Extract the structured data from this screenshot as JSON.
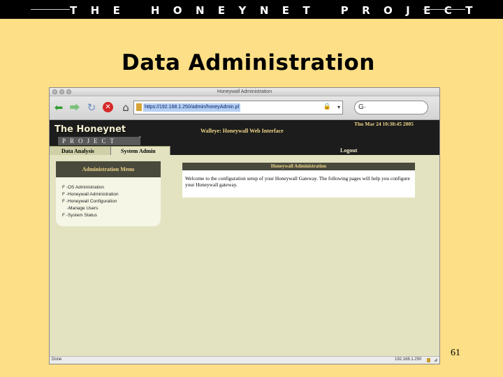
{
  "slide": {
    "header": "THE HONEYNET PROJECT",
    "title": "Data Administration",
    "page_number": "61"
  },
  "browser": {
    "window_title": "Honeywall Administration",
    "url": "https://192.168.1.250/admin/honeyAdmin.pl",
    "search_prefix": "G·",
    "status_left": "Done",
    "status_right": "192.168.1.250"
  },
  "app": {
    "logo_line1": "The Honeynet",
    "logo_line2": "PROJECT",
    "logo_tm": "™",
    "app_title": "Walleye: Honeywall Web Interface",
    "datetime": "Thu Mar 24 10:38:45 2005",
    "tabs": {
      "data_analysis": "Data Analysis",
      "system_admin": "System Admin",
      "logout": "Logout"
    },
    "menu": {
      "title": "Administration Menu",
      "items": [
        "F -OS Administration",
        "F -Honeywall Administration",
        "F -Honeywall Configuration",
        "-Manage Users",
        "F -System Status"
      ]
    },
    "panel": {
      "title": "Honeywall Administration",
      "text": "Welcome to the configuration setup of your Honeywall Gateway. The following pages will help you configure your Honeywall gateway."
    }
  }
}
